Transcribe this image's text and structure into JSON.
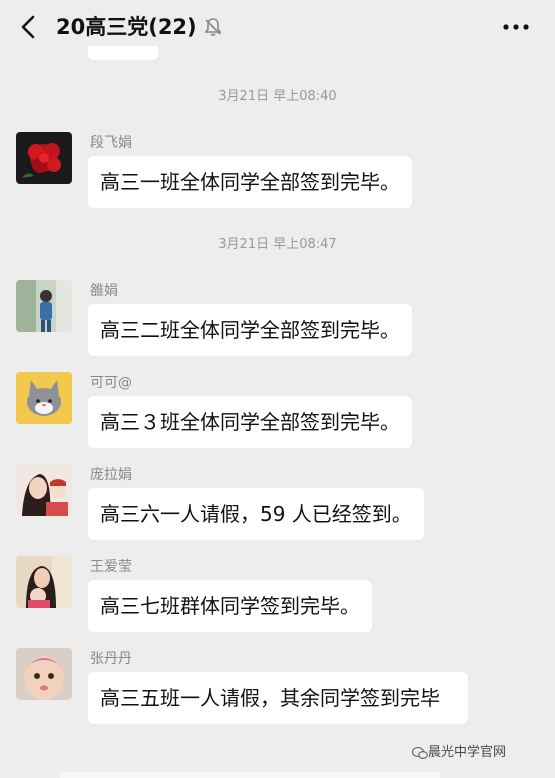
{
  "header": {
    "title": "20高三党(22)",
    "back_icon": "chevron-left-icon",
    "mute_icon": "bell-off-icon",
    "more_icon": "more-horizontal-icon"
  },
  "timestamps": [
    "3月21日 早上08:40",
    "3月21日 早上08:47"
  ],
  "messages": [
    {
      "sender": "段飞娟",
      "text": "高三一班全体同学全部签到完毕。",
      "avatar": "red-flowers"
    },
    {
      "sender": "雒娟",
      "text": "高三二班全体同学全部签到完毕。",
      "avatar": "person-outdoor"
    },
    {
      "sender": "可可@",
      "text": "高三３班全体同学全部签到完毕。",
      "avatar": "cartoon-cat"
    },
    {
      "sender": "庞拉娟",
      "text": "高三六一人请假，59 人已经签到。",
      "avatar": "woman-child"
    },
    {
      "sender": "王爱莹",
      "text": "高三七班群体同学签到完毕。",
      "avatar": "woman-child-2"
    },
    {
      "sender": "张丹丹",
      "text": "高三五班一人请假，其余同学签到完毕",
      "avatar": "baby"
    }
  ],
  "watermark": "晨光中学官网"
}
